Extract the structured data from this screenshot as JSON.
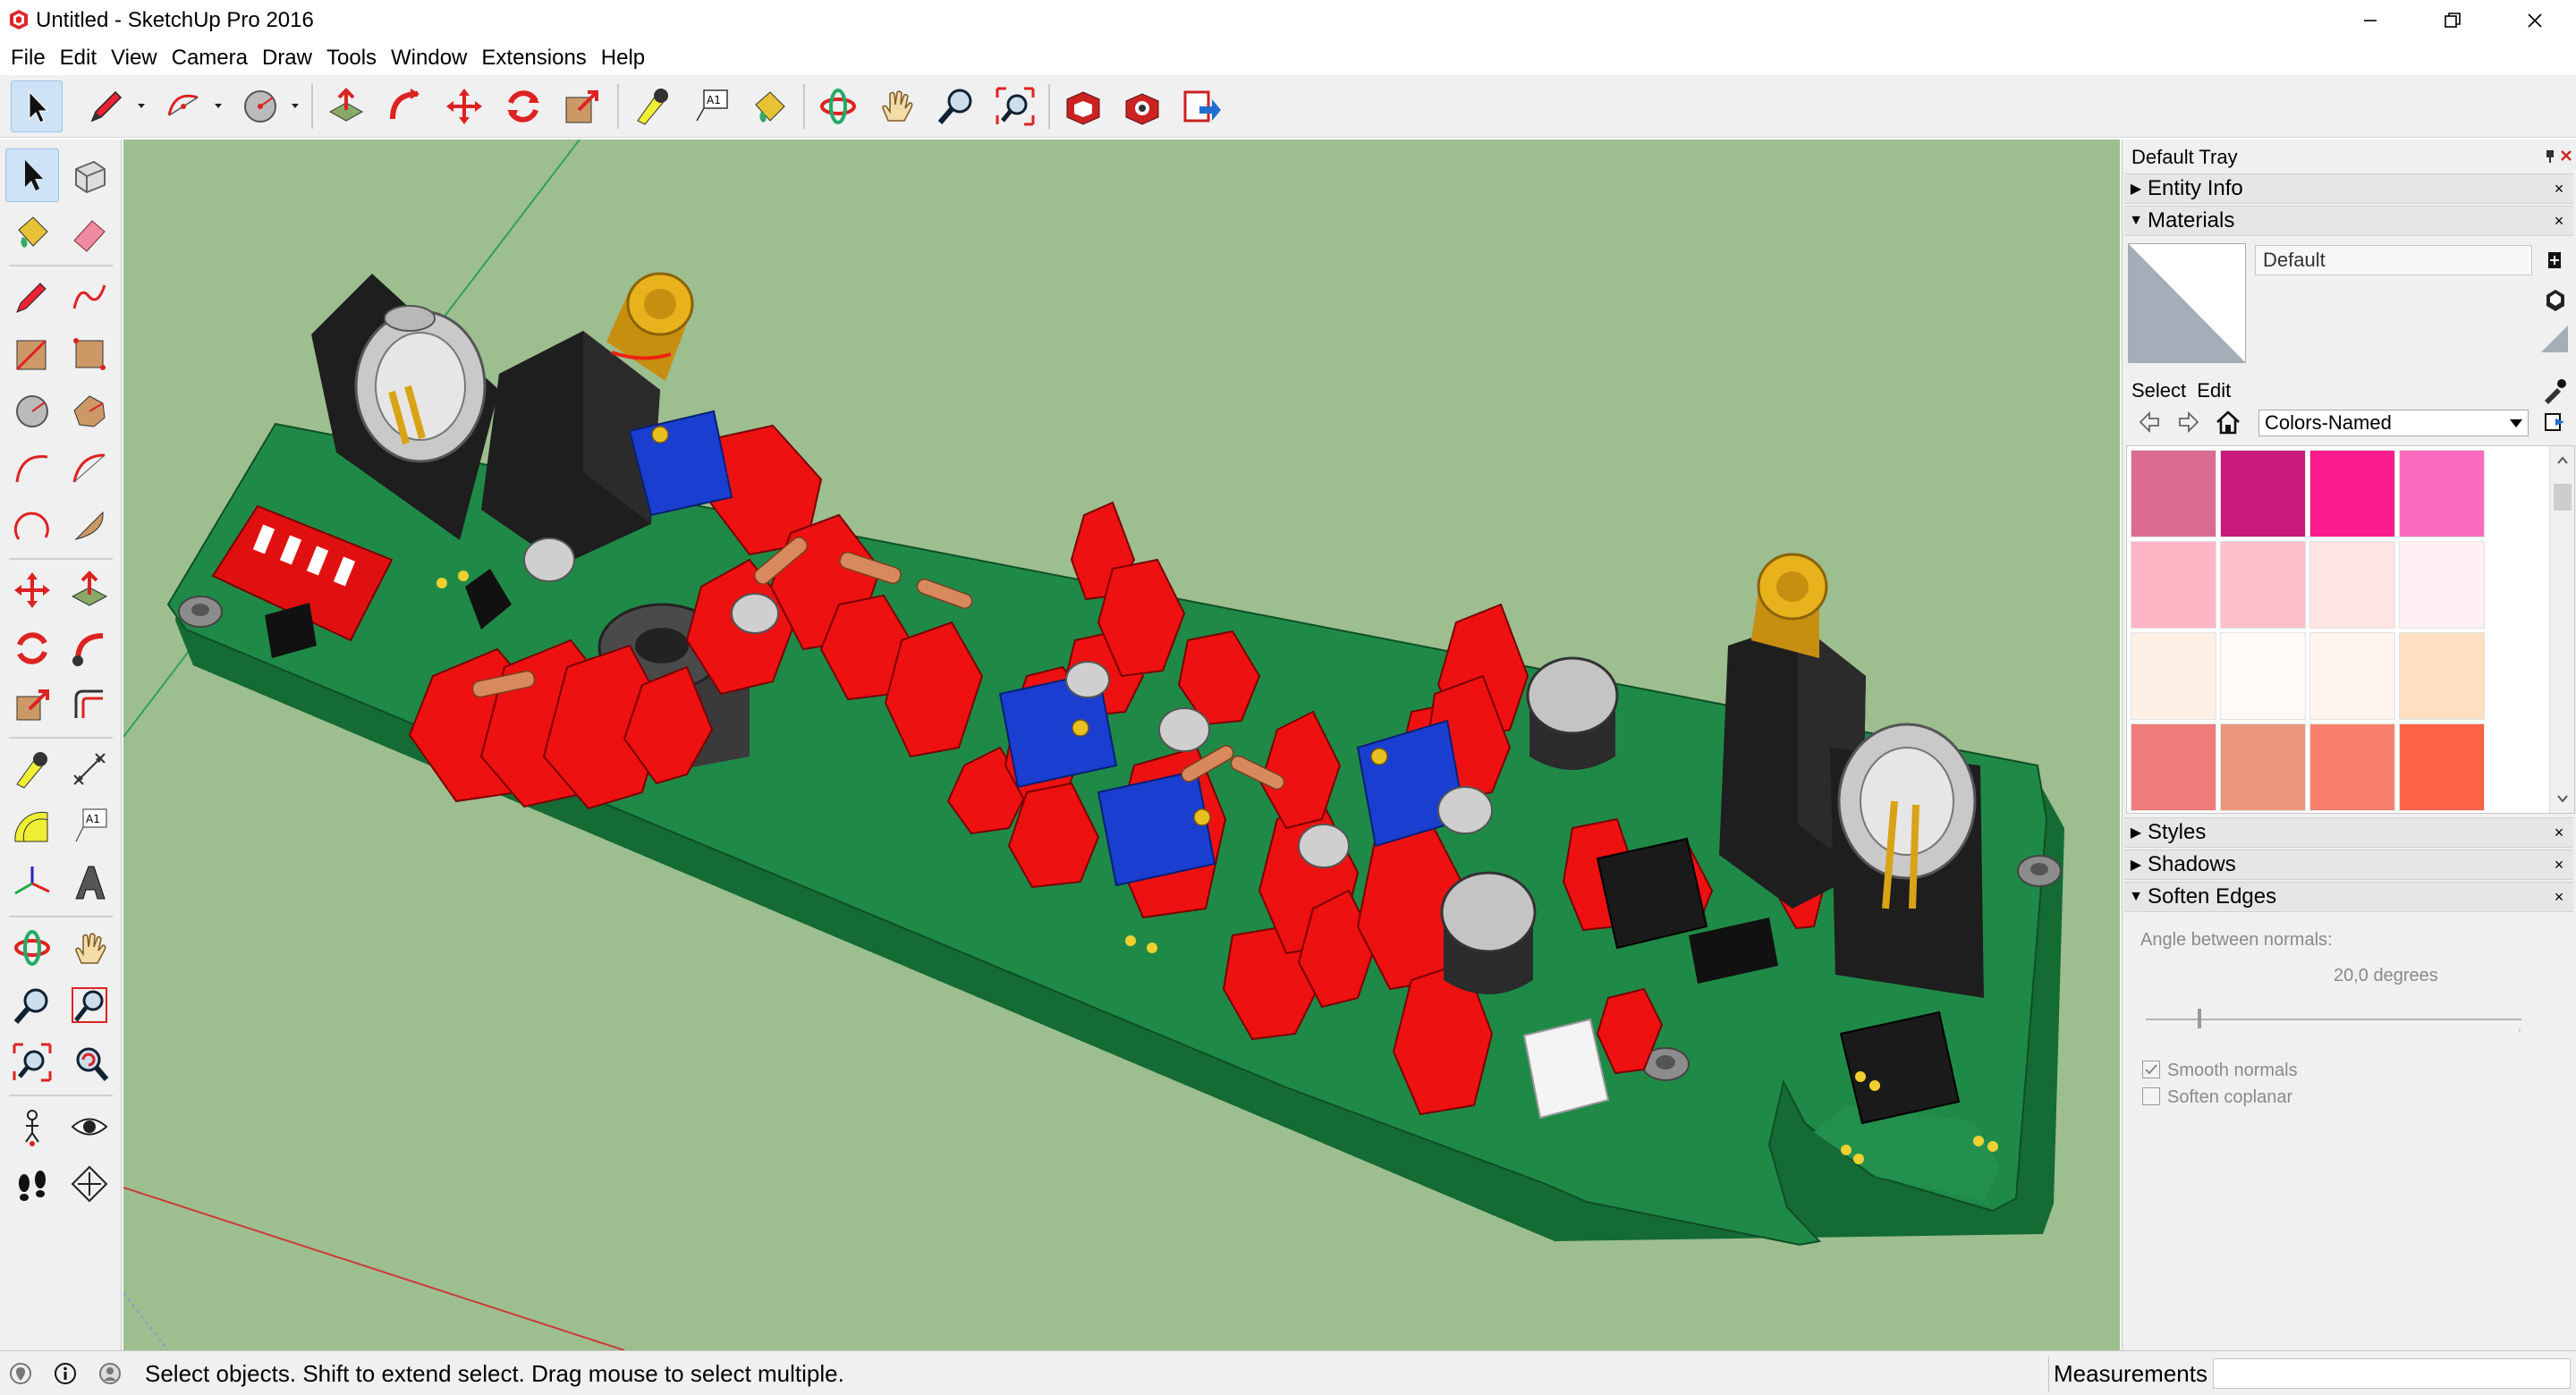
{
  "window": {
    "title": "Untitled - SketchUp Pro 2016",
    "controls": {
      "minimize": "minimize-icon",
      "restore": "restore-icon",
      "close": "close-icon"
    }
  },
  "menu": [
    "File",
    "Edit",
    "View",
    "Camera",
    "Draw",
    "Tools",
    "Window",
    "Extensions",
    "Help"
  ],
  "toolbar": {
    "tools": [
      "select",
      "line",
      "arc",
      "circle",
      "push-pull",
      "follow-me",
      "move",
      "rotate",
      "scale",
      "tape-measure",
      "text",
      "paint-bucket",
      "orbit",
      "pan",
      "zoom",
      "zoom-extents",
      "warehouse",
      "components",
      "send-to-layout"
    ]
  },
  "left_toolbar": {
    "tools": [
      "select",
      "make-component",
      "paint-bucket",
      "eraser",
      "line",
      "freehand",
      "rectangle",
      "rotated-rectangle",
      "circle",
      "polygon",
      "arc",
      "2-point-arc",
      "3-point-arc",
      "pie",
      "move",
      "push-pull",
      "rotate",
      "follow-me",
      "scale",
      "offset",
      "tape-measure",
      "dimension",
      "protractor",
      "text",
      "axes",
      "3d-text",
      "orbit",
      "pan",
      "zoom",
      "zoom-window",
      "zoom-extents",
      "previous",
      "position-camera",
      "look-around",
      "walk",
      "section-plane"
    ]
  },
  "tray": {
    "title": "Default Tray",
    "panels": {
      "entity_info": "Entity Info",
      "materials": "Materials",
      "styles": "Styles",
      "shadows": "Shadows",
      "soften_edges": "Soften Edges"
    },
    "materials": {
      "current": "Default",
      "tab_select": "Select",
      "tab_edit": "Edit",
      "library": "Colors-Named",
      "swatches": [
        "#dc6b94",
        "#c8197c",
        "#fb1b8c",
        "#fa6bbd",
        "#feb5c5",
        "#ffc0cc",
        "#fee4e2",
        "#fff0f4",
        "#fdefe4",
        "#fffaf8",
        "#fff4ee",
        "#fee0c0",
        "#ef7b7a",
        "#e9967b",
        "#f9806f",
        "#fe6247"
      ]
    },
    "soften_edges": {
      "angle_label": "Angle between normals:",
      "angle_value": "20,0  degrees",
      "smooth_normals": "Smooth normals",
      "soften_coplanar": "Soften coplanar",
      "smooth_checked": true,
      "coplanar_checked": false
    }
  },
  "status": {
    "message": "Select objects. Shift to extend select. Drag mouse to select multiple.",
    "measurements_label": "Measurements",
    "icons": [
      "geo-location-icon",
      "info-icon",
      "user-icon"
    ]
  },
  "colors": {
    "viewport_bg": "#9dbe8f",
    "pcb_green": "#1f8a48",
    "pcb_side": "#146b34",
    "component_red": "#ee1111",
    "pot_blue": "#1a3fd0",
    "connector_black": "#1e1e1e",
    "bnc_gold": "#d9a316",
    "accent_select": "#cfe3f7"
  }
}
